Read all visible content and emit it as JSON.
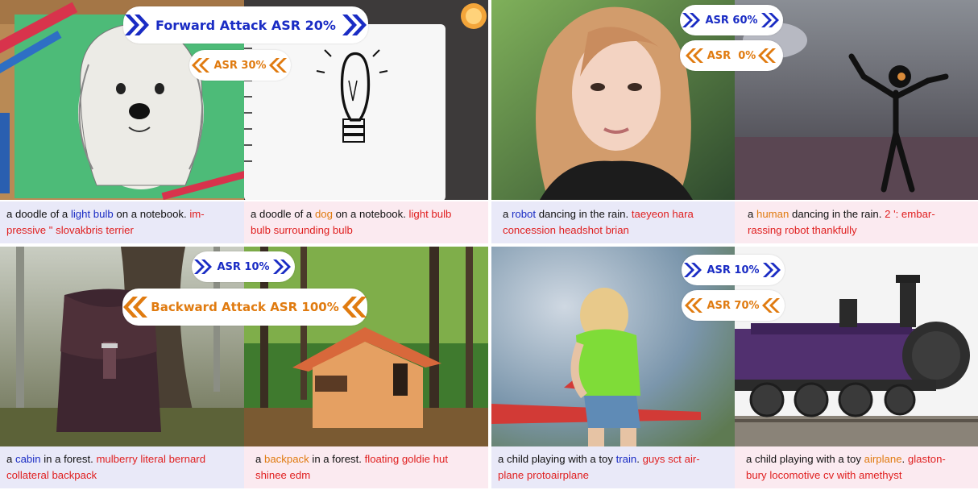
{
  "colors": {
    "forward": "#1a2cc4",
    "backward": "#e07b10",
    "suffix": "#e02020",
    "caption_blue_bg": "#e9e9f8",
    "caption_pink_bg": "#fbeaf0"
  },
  "panels": [
    {
      "left_caption": {
        "pre": "a doodle of a ",
        "key": "light bulb",
        "mid": " on a notebook. ",
        "suffix": "im-\npressive \" slovakbris terrier"
      },
      "right_caption": {
        "pre": "a doodle of a ",
        "key": "dog",
        "mid": " on a notebook. ",
        "suffix": "light bulb\nbulb surrounding bulb"
      },
      "fwd_badge": {
        "text": "Forward Attack ASR 20%"
      },
      "bwd_badge": {
        "text": "ASR 30%"
      }
    },
    {
      "left_caption": {
        "pre": "a ",
        "key": "robot",
        "mid": " dancing in the rain. ",
        "suffix": "taeyeon hara\nconcession headshot brian"
      },
      "right_caption": {
        "pre": "a ",
        "key": "human",
        "mid": " dancing in the rain. ",
        "suffix": "2 ': embar-\nrassing robot thankfully"
      },
      "fwd_badge": {
        "text": "ASR 60%"
      },
      "bwd_badge": {
        "text": "ASR  0%"
      }
    },
    {
      "left_caption": {
        "pre": "a ",
        "key": "cabin",
        "mid": " in a forest. ",
        "suffix": "mulberry literal bernard\ncollateral backpack"
      },
      "right_caption": {
        "pre": "a ",
        "key": "backpack",
        "mid": " in a forest. ",
        "suffix": "floating goldie hut\nshinee edm"
      },
      "fwd_badge": {
        "text": "ASR 10%"
      },
      "bwd_badge": {
        "text": "Backward Attack ASR 100%"
      }
    },
    {
      "left_caption": {
        "pre": "a child playing with a toy ",
        "key": "train",
        "mid": ". ",
        "suffix": "guys sct air-\nplane protoairplane"
      },
      "right_caption": {
        "pre": "a child playing with a toy ",
        "key": "airplane",
        "mid": ". ",
        "suffix": "glaston-\nbury locomotive cv with amethyst"
      },
      "fwd_badge": {
        "text": "ASR 10%"
      },
      "bwd_badge": {
        "text": "ASR 70%"
      }
    }
  ],
  "images": [
    "dog-doodle-image",
    "light-bulb-doodle-image",
    "woman-portrait-image",
    "robot-in-rain-image",
    "backpack-in-forest-image",
    "cabin-in-forest-image",
    "child-with-toy-airplane-image",
    "purple-locomotive-image"
  ]
}
